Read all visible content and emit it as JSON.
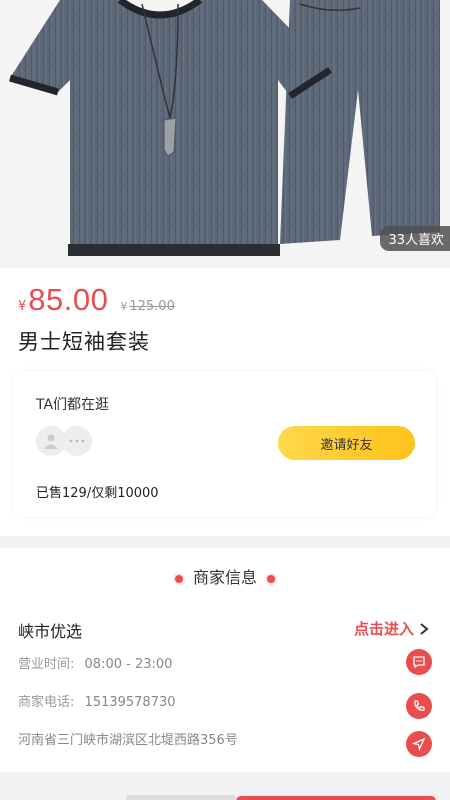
{
  "product": {
    "likes_badge": "33人喜欢",
    "price_symbol": "¥",
    "price": "85.00",
    "original_price_symbol": "¥",
    "original_price": "125.00",
    "title": "男士短袖套装"
  },
  "social": {
    "heading": "TA们都在逛",
    "invite_label": "邀请好友",
    "sold_text": "已售129/仅剩10000"
  },
  "merchant": {
    "section_title": "商家信息",
    "name": "峡市优选",
    "enter_label": "点击进入",
    "hours_label": "营业时间:",
    "hours_value": "08:00 - 23:00",
    "phone_label": "商家电话:",
    "phone_value": "15139578730",
    "address": "河南省三门峡市湖滨区北堤西路356号"
  },
  "colors": {
    "accent": "#e94e4e",
    "invite_button": "#ffc21a"
  },
  "icons": [
    "user-avatar-icon",
    "more-dots-icon",
    "chevron-right-icon",
    "chat-icon",
    "phone-icon",
    "navigation-icon"
  ]
}
